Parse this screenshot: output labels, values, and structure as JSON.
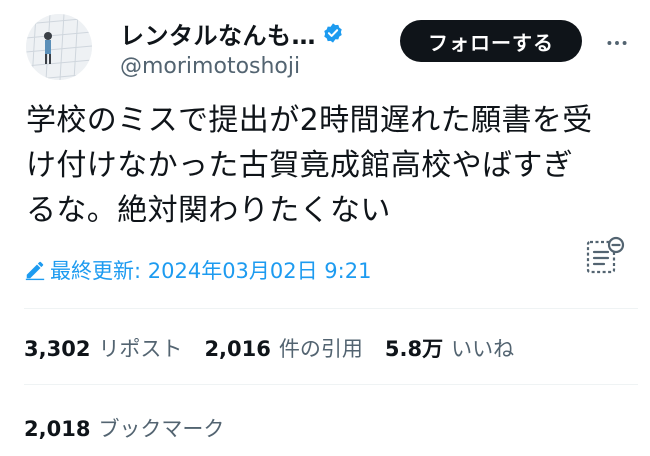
{
  "author": {
    "display_name": "レンタルなんも…",
    "handle": "@morimotoshoji",
    "verified": true
  },
  "follow_button": {
    "label": "フォローする"
  },
  "tweet": {
    "text": "学校のミスで提出が2時間遅れた願書を受\nけ付けなかった古賀竟成館高校やばすぎ\nるな。絶対関わりたくない"
  },
  "edited": {
    "label": "最終更新: 2024年03月02日 9:21"
  },
  "stats": {
    "reposts": {
      "count": "3,302",
      "label": "リポスト"
    },
    "quotes": {
      "count": "2,016",
      "label": "件の引用"
    },
    "likes": {
      "count": "5.8万",
      "label": "いいね"
    },
    "bookmarks": {
      "count": "2,018",
      "label": "ブックマーク"
    }
  },
  "icons": {
    "verified": "verified-badge-icon",
    "more": "more-dots-icon",
    "edited": "pencil-icon",
    "notes": "community-note-icon"
  },
  "colors": {
    "accent": "#1d9bf0",
    "text": "#0f1419",
    "secondary": "#536471",
    "button_bg": "#0f1419"
  }
}
